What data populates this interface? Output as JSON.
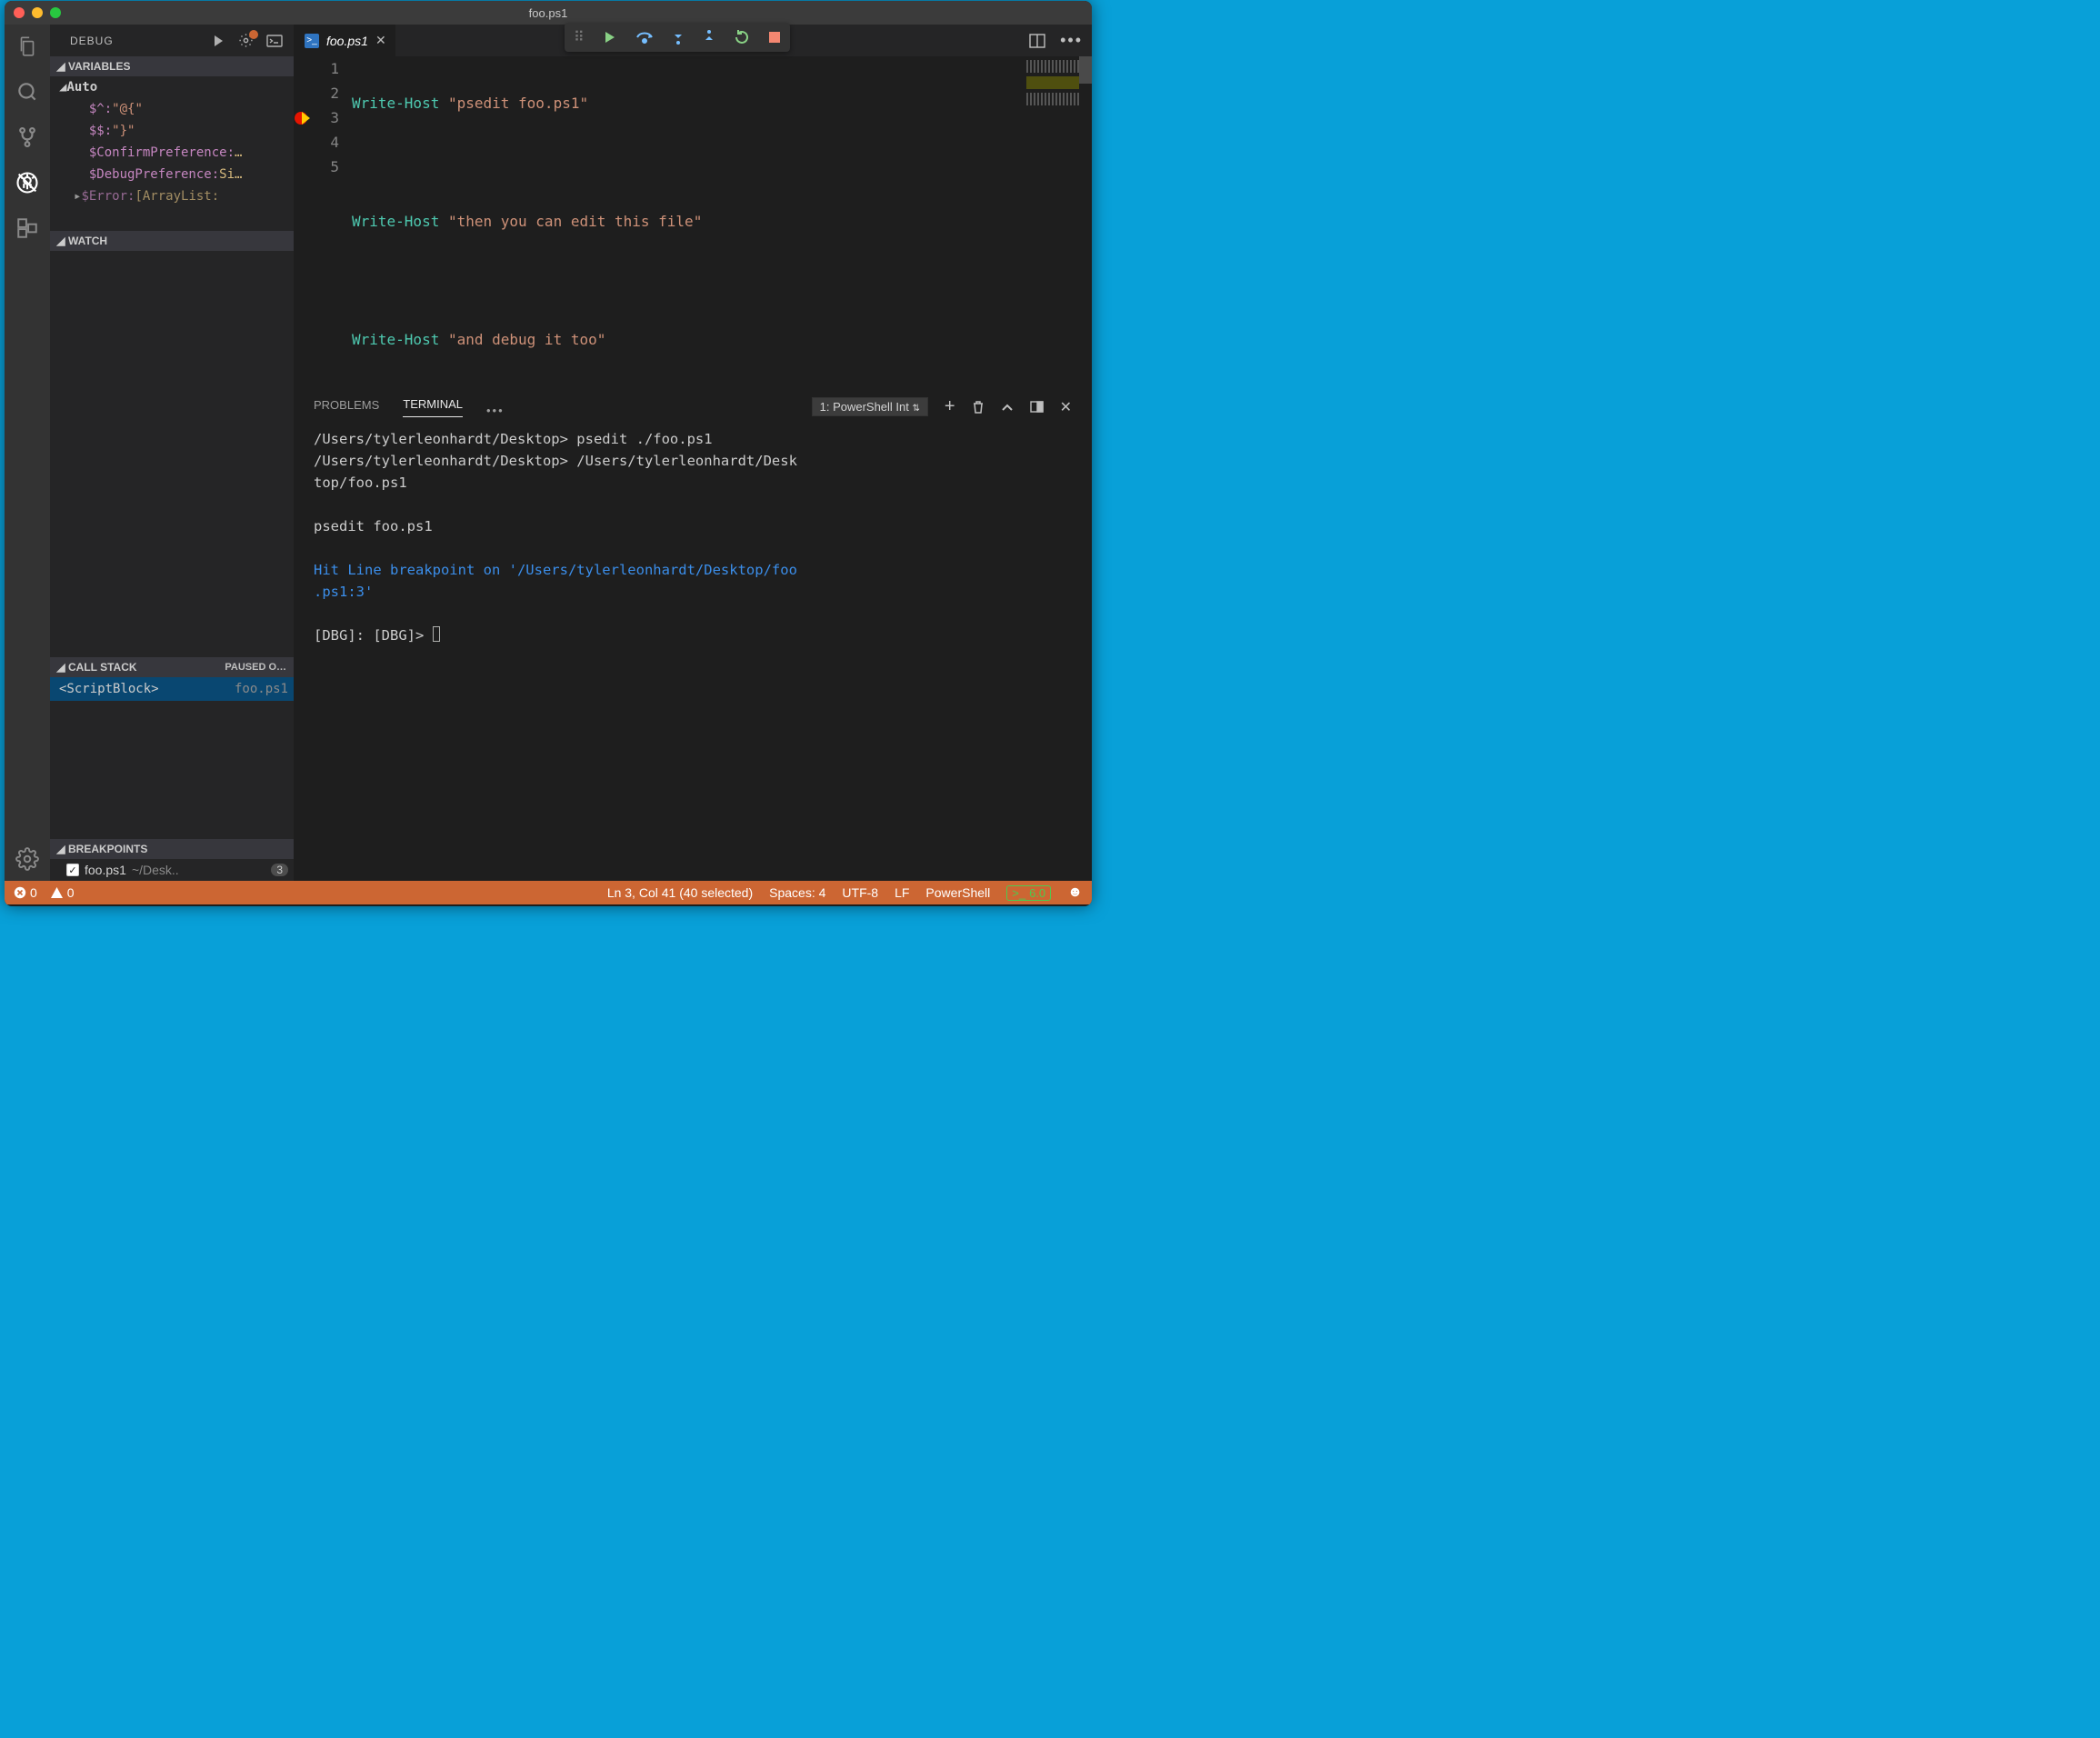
{
  "window": {
    "title": "foo.ps1"
  },
  "activity": {
    "items": [
      "explorer",
      "search",
      "scm",
      "debug",
      "extensions"
    ],
    "bottom": "settings"
  },
  "debugSidebar": {
    "title": "DEBUG",
    "sections": {
      "variables": {
        "title": "VARIABLES",
        "auto_label": "Auto",
        "rows": [
          {
            "name": "$^:",
            "value": "\"@{\""
          },
          {
            "name": "$$:",
            "value": "\"}\""
          },
          {
            "name": "$ConfirmPreference:",
            "value": "…",
            "plain": true
          },
          {
            "name": "$DebugPreference:",
            "value": "Si…",
            "plain": true
          },
          {
            "name": "$Error:",
            "value": "[ArrayList:",
            "plain": true,
            "cut": true
          }
        ]
      },
      "watch": {
        "title": "WATCH"
      },
      "callstack": {
        "title": "CALL STACK",
        "status": "PAUSED O…",
        "row": {
          "name": "<ScriptBlock>",
          "file": "foo.ps1"
        }
      },
      "breakpoints": {
        "title": "BREAKPOINTS",
        "row": {
          "file": "foo.ps1",
          "folder": "~/Desk..",
          "line": "3"
        }
      }
    }
  },
  "tabs": {
    "active": "foo.ps1"
  },
  "debugToolbar": [
    "continue",
    "step-over",
    "step-into",
    "step-out",
    "restart",
    "stop"
  ],
  "editor": {
    "lines": [
      {
        "n": "1",
        "cmd": "Write-Host",
        "str": "\"psedit foo.ps1\""
      },
      {
        "n": "2",
        "cmd": "",
        "str": ""
      },
      {
        "n": "3",
        "cmd": "Write-Host",
        "str": "\"then you can edit this file\"",
        "current": true,
        "bp": true
      },
      {
        "n": "4",
        "cmd": "",
        "str": ""
      },
      {
        "n": "5",
        "cmd": "Write-Host",
        "str": "\"and debug it too\""
      }
    ]
  },
  "panel": {
    "tabs": {
      "problems": "PROBLEMS",
      "terminal": "TERMINAL"
    },
    "terminalSelect": "1: PowerShell Int",
    "terminal": {
      "l1": "/Users/tylerleonhardt/Desktop> psedit ./foo.ps1",
      "l2": "/Users/tylerleonhardt/Desktop> /Users/tylerleonhardt/Desk",
      "l3": "top/foo.ps1",
      "l4": "psedit foo.ps1",
      "l5": "Hit Line breakpoint on '/Users/tylerleonhardt/Desktop/foo",
      "l6": ".ps1:3'",
      "l7": "[DBG]:  [DBG]> "
    }
  },
  "statusbar": {
    "errors": "0",
    "warnings": "0",
    "pos": "Ln 3, Col 41 (40 selected)",
    "spaces": "Spaces: 4",
    "enc": "UTF-8",
    "eol": "LF",
    "lang": "PowerShell",
    "psver": "6.0"
  }
}
